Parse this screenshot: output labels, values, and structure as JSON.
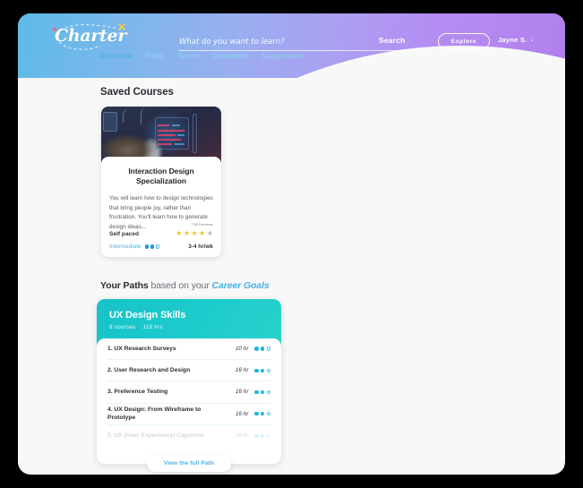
{
  "header": {
    "logo_text": "Charter",
    "search": {
      "placeholder": "What do you want to learn?",
      "value": "",
      "button_label": "Search"
    },
    "explore_label": "Explore",
    "user": {
      "name": "Jayne S.",
      "caret": "↓"
    }
  },
  "nav": {
    "tabs": [
      {
        "label": "Overview",
        "active": true
      },
      {
        "label": "Paths",
        "active": false
      },
      {
        "label": "Saved",
        "active": false
      },
      {
        "label": "Completed",
        "active": false
      },
      {
        "label": "Suggestions",
        "active": false
      }
    ]
  },
  "saved_courses": {
    "title": "Saved Courses",
    "card": {
      "title": "Interaction Design Specialization",
      "description": "You will learn how to design technologies that bring people joy, rather than frustration. You'll learn how to generate design ideas...",
      "reviews": "738 Reviews",
      "pace": "Self paced",
      "rating": 4,
      "rating_max": 5,
      "difficulty_label": "Intermediate",
      "difficulty_filled": 2,
      "difficulty_total": 3,
      "hours_per_week": "3-4 hr/wk"
    }
  },
  "paths": {
    "heading_bold": "Your Paths",
    "heading_mid": " based on your ",
    "heading_link": "Career Goals",
    "card": {
      "title": "UX Design Skills",
      "courses_count": "6 courses",
      "total_hours": "116 hrs",
      "items": [
        {
          "name": "1. UX Research Surveys",
          "hours": "10 hr",
          "dots_filled": 2,
          "dots_total": 3,
          "faded": false
        },
        {
          "name": "2. User Research and Design",
          "hours": "16 hr",
          "dots_filled": 2,
          "dots_total": 3,
          "faded": false
        },
        {
          "name": "3. Preference Testing",
          "hours": "16 hr",
          "dots_filled": 2,
          "dots_total": 3,
          "faded": false
        },
        {
          "name": "4. UX Design: From Wireframe to Prototype",
          "hours": "16 hr",
          "dots_filled": 2,
          "dots_total": 3,
          "faded": false
        },
        {
          "name": "5. UX (User Experience) Capstone",
          "hours": "16 hr",
          "dots_filled": 2,
          "dots_total": 3,
          "faded": true
        }
      ]
    },
    "view_full_label": "View the full Path"
  },
  "colors": {
    "header_start": "#5ebbe8",
    "header_end": "#b07fec",
    "accent_blue": "#4cb7e8",
    "teal_start": "#17c3c9",
    "teal_end": "#2fd6c8",
    "star_gold": "#f5bf27",
    "canvas": "#f8f8f8",
    "page_bg": "#000000"
  }
}
